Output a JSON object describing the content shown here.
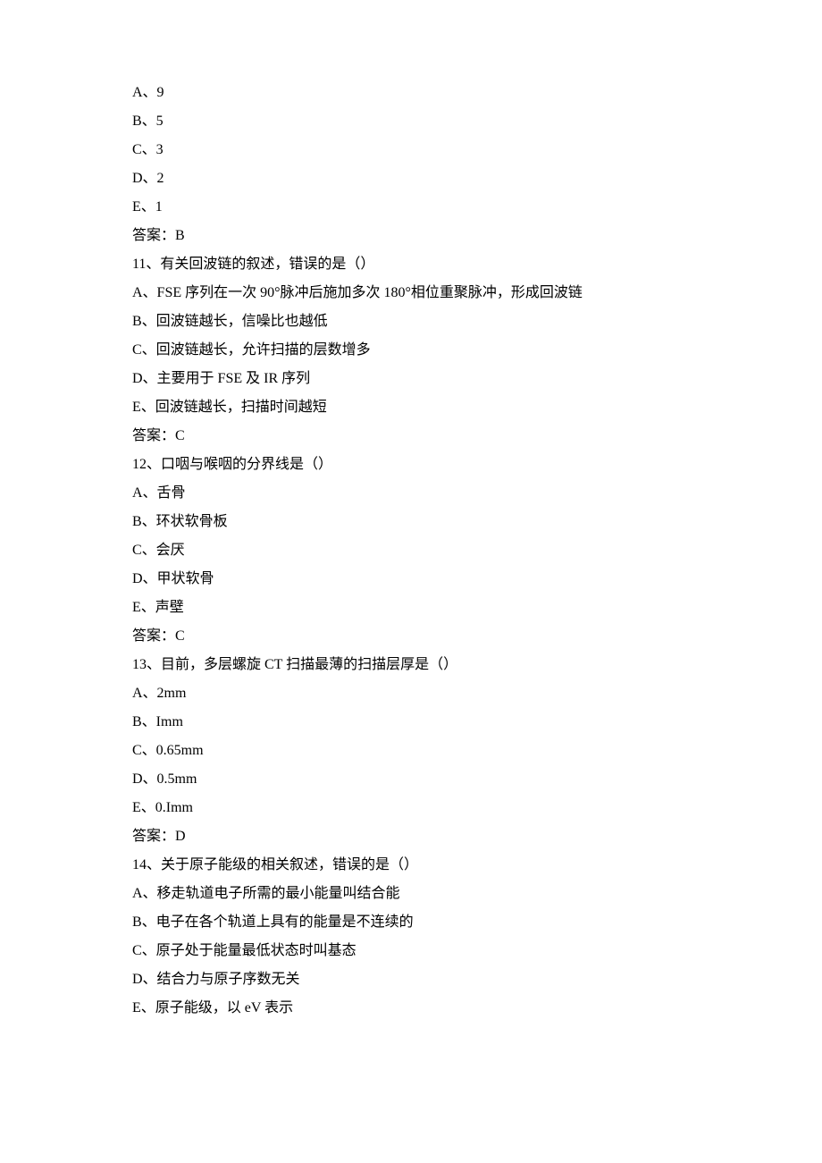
{
  "q10": {
    "optA": "A、9",
    "optB": "B、5",
    "optC": "C、3",
    "optD": "D、2",
    "optE": "E、1",
    "answer": "答案：B"
  },
  "q11": {
    "stem": "11、有关回波链的叙述，错误的是（）",
    "optA": "A、FSE 序列在一次 90°脉冲后施加多次 180°相位重聚脉冲，形成回波链",
    "optB": "B、回波链越长，信噪比也越低",
    "optC": "C、回波链越长，允许扫描的层数增多",
    "optD": "D、主要用于 FSE 及 IR 序列",
    "optE": "E、回波链越长，扫描时间越短",
    "answer": "答案：C"
  },
  "q12": {
    "stem": "12、口咽与喉咽的分界线是（）",
    "optA": "A、舌骨",
    "optB": "B、环状软骨板",
    "optC": "C、会厌",
    "optD": "D、甲状软骨",
    "optE": "E、声壁",
    "answer": "答案：C"
  },
  "q13": {
    "stem": "13、目前，多层螺旋 CT 扫描最薄的扫描层厚是（）",
    "optA": "A、2mm",
    "optB": "B、Imm",
    "optC": "C、0.65mm",
    "optD": "D、0.5mm",
    "optE": "E、0.Imm",
    "answer": "答案：D"
  },
  "q14": {
    "stem": "14、关于原子能级的相关叙述，错误的是（）",
    "optA": "A、移走轨道电子所需的最小能量叫结合能",
    "optB": "B、电子在各个轨道上具有的能量是不连续的",
    "optC": "C、原子处于能量最低状态时叫基态",
    "optD": "D、结合力与原子序数无关",
    "optE": "E、原子能级，以 eV 表示"
  }
}
